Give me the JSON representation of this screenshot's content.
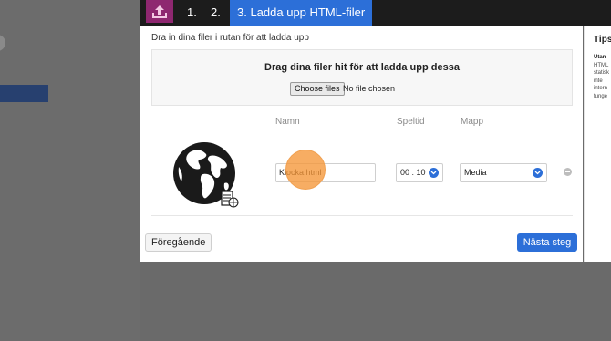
{
  "steps": {
    "step1": "1.",
    "step2": "2.",
    "step3": "3. Ladda upp HTML-filer"
  },
  "upload": {
    "instruction": "Dra in dina filer i rutan för att ladda upp",
    "dropzone_title": "Drag dina filer hit för att ladda upp dessa",
    "choose_files_label": "Choose files",
    "no_file_text": "No file chosen"
  },
  "columns": {
    "name": "Namn",
    "playtime": "Speltid",
    "folder": "Mapp"
  },
  "file_row": {
    "name_value": "Klocka.html",
    "playtime_value": "00 : 10",
    "folder_value": "Media"
  },
  "buttons": {
    "previous": "Föregående",
    "next": "Nästa steg"
  },
  "tips": {
    "title": "Tips",
    "heading": "Utan",
    "body": "HTML\nstatisk\ninte\nintern\nfunge"
  },
  "colors": {
    "accent": "#2c6fd8",
    "upload_badge": "#8e2770",
    "cursor": "#f59637"
  }
}
